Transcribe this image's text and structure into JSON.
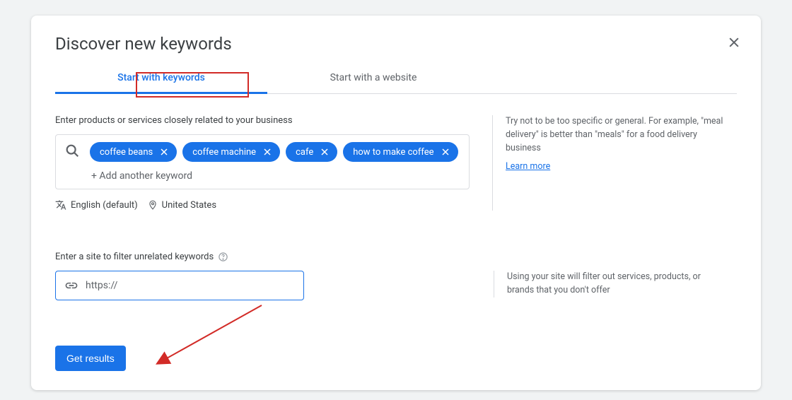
{
  "title": "Discover new keywords",
  "tabs": {
    "keywords": "Start with keywords",
    "website": "Start with a website"
  },
  "section1": {
    "prompt": "Enter products or services closely related to your business",
    "chips": [
      "coffee beans",
      "coffee machine",
      "cafe",
      "how to make coffee"
    ],
    "add_label": "+ Add another keyword",
    "language": "English (default)",
    "location": "United States",
    "tip": "Try not to be too specific or general. For example, \"meal delivery\" is better than \"meals\" for a food delivery business",
    "learn": "Learn more"
  },
  "section2": {
    "prompt": "Enter a site to filter unrelated keywords",
    "placeholder": "https://",
    "tip": "Using your site will filter out services, products, or brands that you don't offer"
  },
  "submit": "Get results"
}
